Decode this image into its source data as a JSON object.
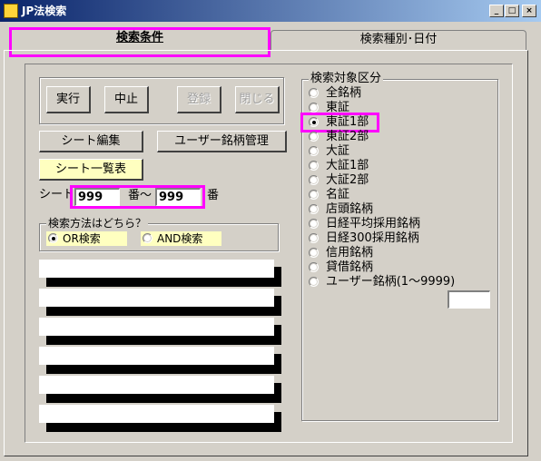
{
  "window": {
    "title": "JP法検索",
    "minimize": "_",
    "maximize": "□",
    "close": "×"
  },
  "tabs": [
    {
      "label": "検索条件",
      "active": true
    },
    {
      "label": "検索種別･日付",
      "active": false
    }
  ],
  "buttons": {
    "execute": "実行",
    "stop": "中止",
    "register": "登録",
    "close": "閉じる",
    "sheet_edit": "シート編集",
    "user_stock_manage": "ユーザー銘柄管理",
    "sheet_list": "シート一覧表"
  },
  "sheet_range": {
    "label": "シート",
    "from_value": "999",
    "sep": "番～",
    "to_value": "999",
    "suffix": "番"
  },
  "search_method": {
    "title": "検索方法はどちら？",
    "options": [
      {
        "label": "OR検索",
        "selected": true
      },
      {
        "label": "AND検索",
        "selected": false
      }
    ]
  },
  "target": {
    "title": "検索対象区分",
    "options": [
      {
        "label": "全銘柄",
        "selected": false
      },
      {
        "label": "東証",
        "selected": false
      },
      {
        "label": "東証1部",
        "selected": true
      },
      {
        "label": "東証2部",
        "selected": false
      },
      {
        "label": "大証",
        "selected": false
      },
      {
        "label": "大証1部",
        "selected": false
      },
      {
        "label": "大証2部",
        "selected": false
      },
      {
        "label": "名証",
        "selected": false
      },
      {
        "label": "店頭銘柄",
        "selected": false
      },
      {
        "label": "日経平均採用銘柄",
        "selected": false
      },
      {
        "label": "日経300採用銘柄",
        "selected": false
      },
      {
        "label": "信用銘柄",
        "selected": false
      },
      {
        "label": "貸借銘柄",
        "selected": false
      },
      {
        "label": "ユーザー銘柄(1～9999)",
        "selected": false
      }
    ],
    "user_input_value": ""
  },
  "colors": {
    "titlebar_start": "#0a246a",
    "titlebar_end": "#a6caf0",
    "highlight": "#ff00ff",
    "chip": "#ffffc0"
  }
}
